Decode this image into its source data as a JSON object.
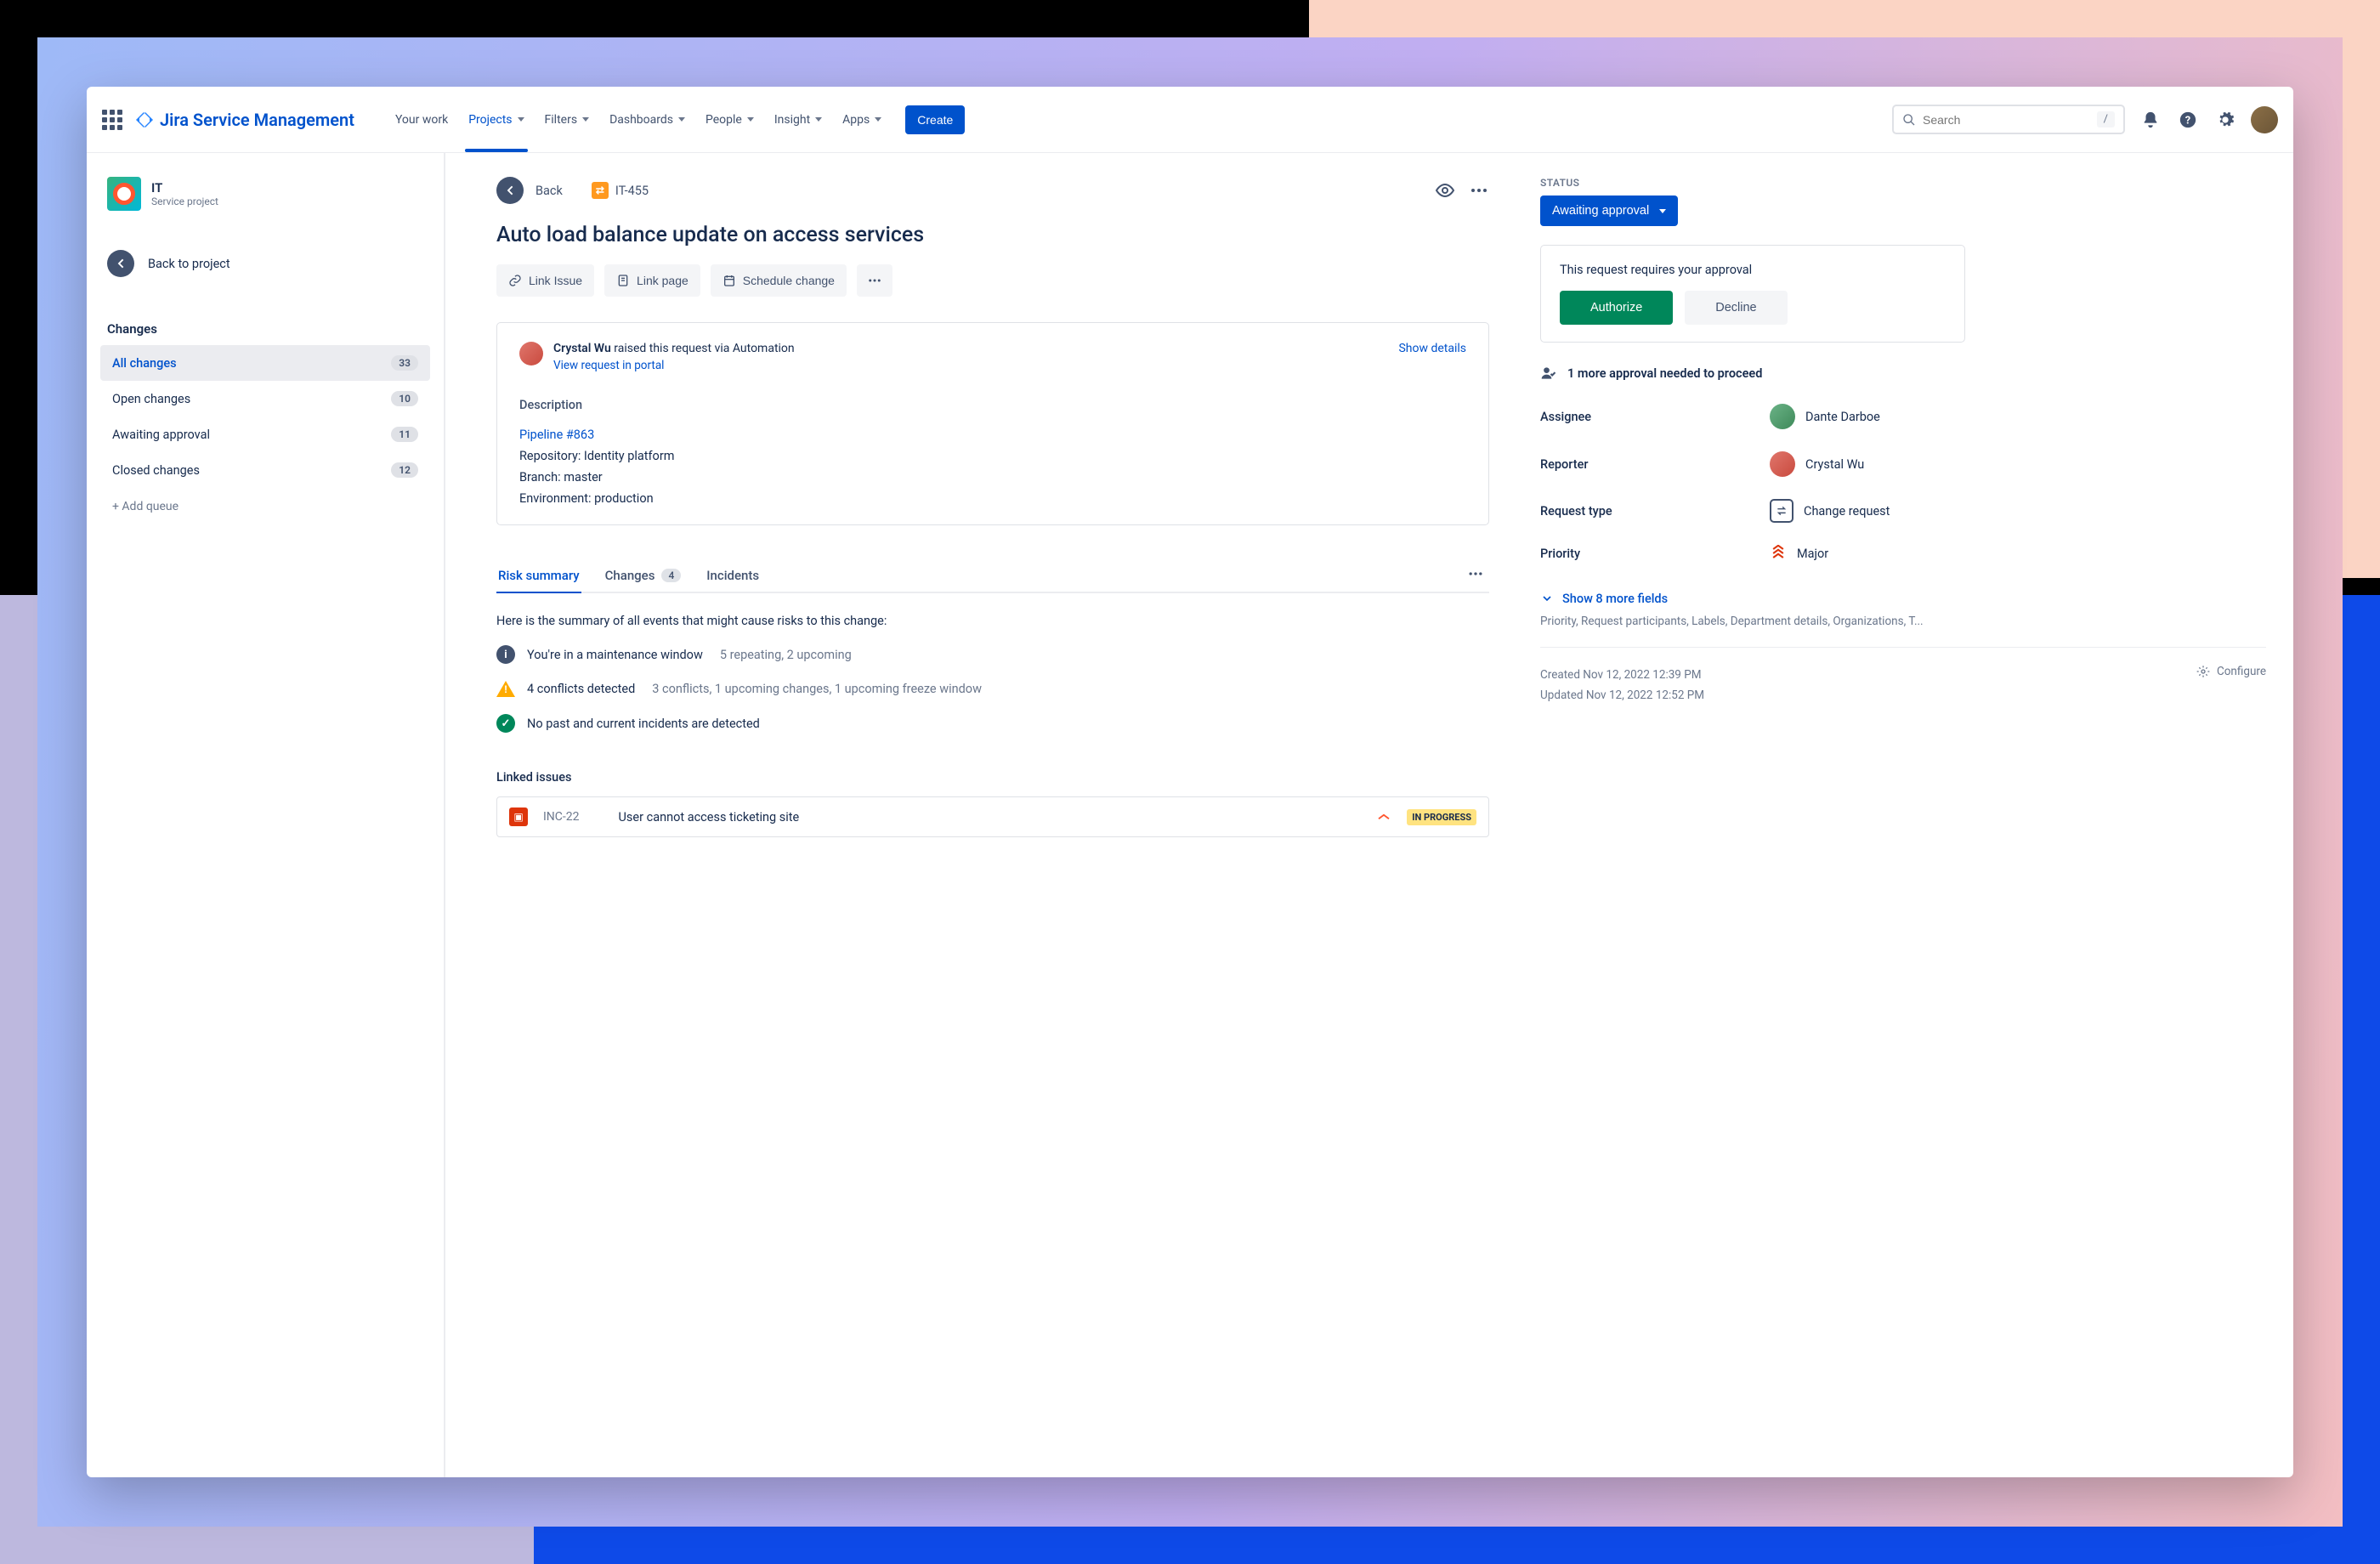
{
  "header": {
    "product": "Jira Service Management",
    "nav": [
      "Your work",
      "Projects",
      "Filters",
      "Dashboards",
      "People",
      "Insight",
      "Apps"
    ],
    "active_nav": "Projects",
    "create": "Create",
    "search_placeholder": "Search",
    "key_hint": "/"
  },
  "sidebar": {
    "project_name": "IT",
    "project_type": "Service project",
    "back_to_project": "Back to project",
    "section": "Changes",
    "queues": [
      {
        "name": "All changes",
        "count": "33",
        "active": true
      },
      {
        "name": "Open changes",
        "count": "10"
      },
      {
        "name": "Awaiting approval",
        "count": "11"
      },
      {
        "name": "Closed changes",
        "count": "12"
      }
    ],
    "add_queue": "+ Add queue"
  },
  "breadcrumb": {
    "back": "Back",
    "issue_key": "IT-455"
  },
  "issue": {
    "title": "Auto load balance update on access services",
    "actions": [
      "Link Issue",
      "Link page",
      "Schedule change"
    ],
    "requester_name": "Crystal Wu",
    "requester_suffix": " raised this request via Automation",
    "show_details": "Show details",
    "view_portal": "View request in portal",
    "description_label": "Description",
    "pipeline_link": "Pipeline #863",
    "desc_lines": [
      "Repository: Identity platform",
      "Branch: master",
      "Environment: production"
    ]
  },
  "tabs": {
    "items": [
      {
        "label": "Risk summary",
        "active": true
      },
      {
        "label": "Changes",
        "badge": "4"
      },
      {
        "label": "Incidents"
      }
    ]
  },
  "risk": {
    "intro": "Here is the summary of all events that might cause risks to this change:",
    "items": [
      {
        "icon": "info",
        "main": "You're in a maintenance window",
        "sub": "5 repeating, 2 upcoming"
      },
      {
        "icon": "warn",
        "main": "4 conflicts detected",
        "sub": "3 conflicts, 1 upcoming changes, 1 upcoming freeze window"
      },
      {
        "icon": "ok",
        "main": "No past and current incidents are detected",
        "sub": ""
      }
    ]
  },
  "linked": {
    "title": "Linked issues",
    "key": "INC-22",
    "summary": "User cannot access ticketing site",
    "status": "IN PROGRESS"
  },
  "right": {
    "status_label": "STATUS",
    "status_value": "Awaiting approval",
    "approval_msg": "This request requires your approval",
    "authorize": "Authorize",
    "decline": "Decline",
    "approval_note": "1 more approval needed to proceed",
    "fields": {
      "assignee_label": "Assignee",
      "assignee": "Dante Darboe",
      "reporter_label": "Reporter",
      "reporter": "Crystal Wu",
      "reqtype_label": "Request type",
      "reqtype": "Change request",
      "priority_label": "Priority",
      "priority": "Major"
    },
    "show_more": "Show 8 more fields",
    "more_hint": "Priority, Request participants, Labels, Department details, Organizations, T...",
    "created": "Created Nov 12, 2022 12:39 PM",
    "updated": "Updated Nov 12, 2022 12:52 PM",
    "configure": "Configure"
  }
}
